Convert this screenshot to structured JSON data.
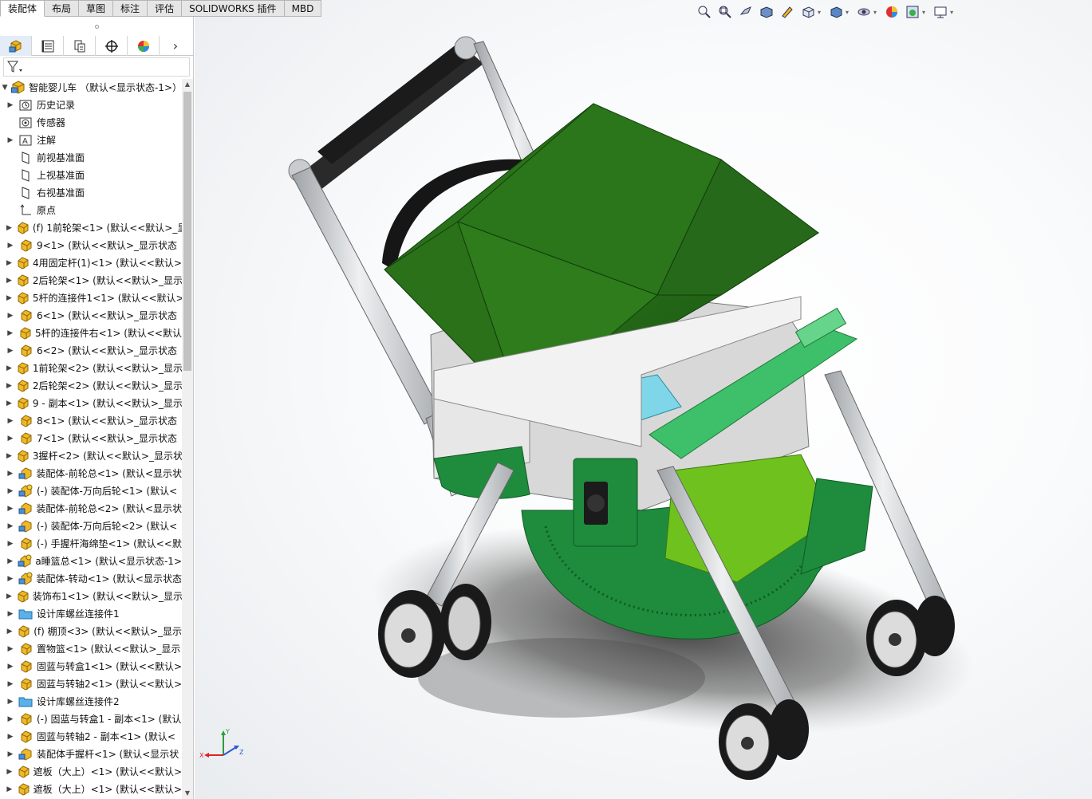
{
  "tabs": [
    "装配体",
    "布局",
    "草图",
    "标注",
    "评估",
    "SOLIDWORKS 插件",
    "MBD"
  ],
  "manager_tabs": [
    "featuremanager-icon",
    "propertymanager-icon",
    "configurationmanager-icon",
    "dimxpert-icon",
    "displaymanager-icon"
  ],
  "tree": {
    "root": "智能婴儿车 （默认<显示状态-1>）",
    "items": [
      {
        "label": "历史记录",
        "icon": "history-icon",
        "caret": true
      },
      {
        "label": "传感器",
        "icon": "sensor-icon",
        "caret": false
      },
      {
        "label": "注解",
        "icon": "annotation-icon",
        "caret": true
      },
      {
        "label": "前视基准面",
        "icon": "plane-icon",
        "caret": false
      },
      {
        "label": "上视基准面",
        "icon": "plane-icon",
        "caret": false
      },
      {
        "label": "右视基准面",
        "icon": "plane-icon",
        "caret": false
      },
      {
        "label": "原点",
        "icon": "origin-icon",
        "caret": false
      },
      {
        "label": "(f) 1前轮架<1> (默认<<默认>_显",
        "icon": "part-icon",
        "caret": true
      },
      {
        "label": "9<1> (默认<<默认>_显示状态",
        "icon": "part-icon",
        "caret": true
      },
      {
        "label": "4用固定杆(1)<1> (默认<<默认>",
        "icon": "part-icon",
        "caret": true
      },
      {
        "label": "2后轮架<1> (默认<<默认>_显示",
        "icon": "part-icon",
        "caret": true
      },
      {
        "label": "5杆的连接件1<1> (默认<<默认>",
        "icon": "part-icon",
        "caret": true
      },
      {
        "label": "6<1> (默认<<默认>_显示状态",
        "icon": "part-icon",
        "caret": true
      },
      {
        "label": "5杆的连接件右<1> (默认<<默认",
        "icon": "part-icon",
        "caret": true
      },
      {
        "label": "6<2> (默认<<默认>_显示状态",
        "icon": "part-icon",
        "caret": true
      },
      {
        "label": "1前轮架<2> (默认<<默认>_显示",
        "icon": "part-icon",
        "caret": true
      },
      {
        "label": "2后轮架<2> (默认<<默认>_显示",
        "icon": "part-icon",
        "caret": true
      },
      {
        "label": "9 - 副本<1> (默认<<默认>_显示",
        "icon": "part-icon",
        "caret": true
      },
      {
        "label": "8<1> (默认<<默认>_显示状态",
        "icon": "part-icon",
        "caret": true
      },
      {
        "label": "7<1> (默认<<默认>_显示状态",
        "icon": "part-icon",
        "caret": true
      },
      {
        "label": "3握杆<2> (默认<<默认>_显示状",
        "icon": "part-icon",
        "caret": true
      },
      {
        "label": "装配体-前轮总<1> (默认<显示状",
        "icon": "assembly-icon",
        "caret": true
      },
      {
        "label": "(-) 装配体-万向后轮<1> (默认<",
        "icon": "assembly-warn-icon",
        "caret": true
      },
      {
        "label": "装配体-前轮总<2> (默认<显示状",
        "icon": "assembly-icon",
        "caret": true
      },
      {
        "label": "(-) 装配体-万向后轮<2> (默认<",
        "icon": "assembly-icon",
        "caret": true
      },
      {
        "label": "(-) 手握杆海绵垫<1> (默认<<默",
        "icon": "part-icon",
        "caret": true
      },
      {
        "label": "a睡篮总<1> (默认<显示状态-1>",
        "icon": "assembly-warn-icon",
        "caret": true
      },
      {
        "label": "装配体-转动<1> (默认<显示状态",
        "icon": "assembly-warn-icon",
        "caret": true
      },
      {
        "label": "装饰布1<1> (默认<<默认>_显示",
        "icon": "part-icon",
        "caret": true
      },
      {
        "label": "设计库螺丝连接件1",
        "icon": "folder-icon",
        "caret": true
      },
      {
        "label": "(f) 棚顶<3> (默认<<默认>_显示",
        "icon": "part-icon",
        "caret": true
      },
      {
        "label": "置物篮<1> (默认<<默认>_显示",
        "icon": "part-icon",
        "caret": true
      },
      {
        "label": "固蓝与转盒1<1> (默认<<默认>",
        "icon": "part-icon",
        "caret": true
      },
      {
        "label": "固蓝与转轴2<1> (默认<<默认>",
        "icon": "part-icon",
        "caret": true
      },
      {
        "label": "设计库螺丝连接件2",
        "icon": "folder-icon",
        "caret": true
      },
      {
        "label": "(-) 固蓝与转盒1 - 副本<1> (默认",
        "icon": "part-icon",
        "caret": true
      },
      {
        "label": "固蓝与转轴2 - 副本<1> (默认<",
        "icon": "part-icon",
        "caret": true
      },
      {
        "label": "装配体手握杆<1> (默认<显示状",
        "icon": "assembly-icon",
        "caret": true
      },
      {
        "label": "遮板（大上）<1> (默认<<默认>",
        "icon": "part-icon",
        "caret": true
      },
      {
        "label": "遮板（大上）<1> (默认<<默认>",
        "icon": "part-icon",
        "caret": true
      }
    ]
  },
  "hud_icons": [
    "zoom-to-fit-icon",
    "zoom-to-area-icon",
    "previous-view-icon",
    "section-view-icon",
    "dynamic-annotation-icon",
    "view-orientation-icon",
    "display-style-icon",
    "hide-show-icon",
    "edit-appearance-icon",
    "apply-scene-icon",
    "view-settings-icon"
  ],
  "colors": {
    "canopy": "#2f7d1f",
    "canopy_dark": "#1f5c14",
    "shell": "#1e8a3a",
    "light_green": "#3ec06a",
    "lime": "#6fc21e",
    "frame": "#c8cbce",
    "tire": "#1a1a1a"
  },
  "triad": {
    "x": "X",
    "y": "Y",
    "z": "Z"
  }
}
